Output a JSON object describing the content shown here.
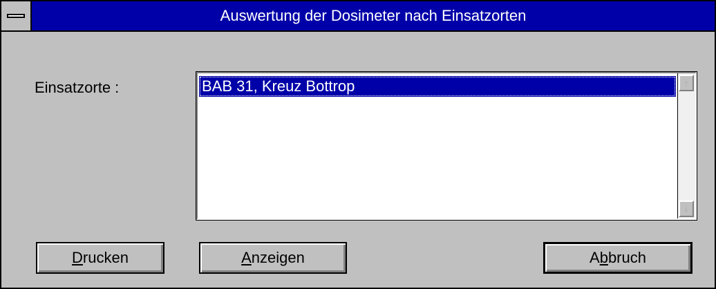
{
  "window": {
    "title": "Auswertung der Dosimeter nach Einsatzorten"
  },
  "form": {
    "label": "Einsatzorte :",
    "list_items": [
      {
        "label": "BAB 31, Kreuz Bottrop",
        "selected": true
      }
    ]
  },
  "buttons": {
    "print": {
      "prefix": "",
      "mnemonic": "D",
      "rest": "rucken"
    },
    "show": {
      "prefix": "",
      "mnemonic": "A",
      "rest": "nzeigen"
    },
    "cancel": {
      "prefix": "A",
      "mnemonic": "b",
      "rest": "bruch"
    }
  },
  "icons": {
    "system_menu": "system-menu-icon",
    "scroll_up": "arrow-up-icon",
    "scroll_down": "arrow-down-icon"
  },
  "colors": {
    "titlebar": "#0000a8",
    "face": "#c0c0c0",
    "selection": "#0000a8"
  }
}
